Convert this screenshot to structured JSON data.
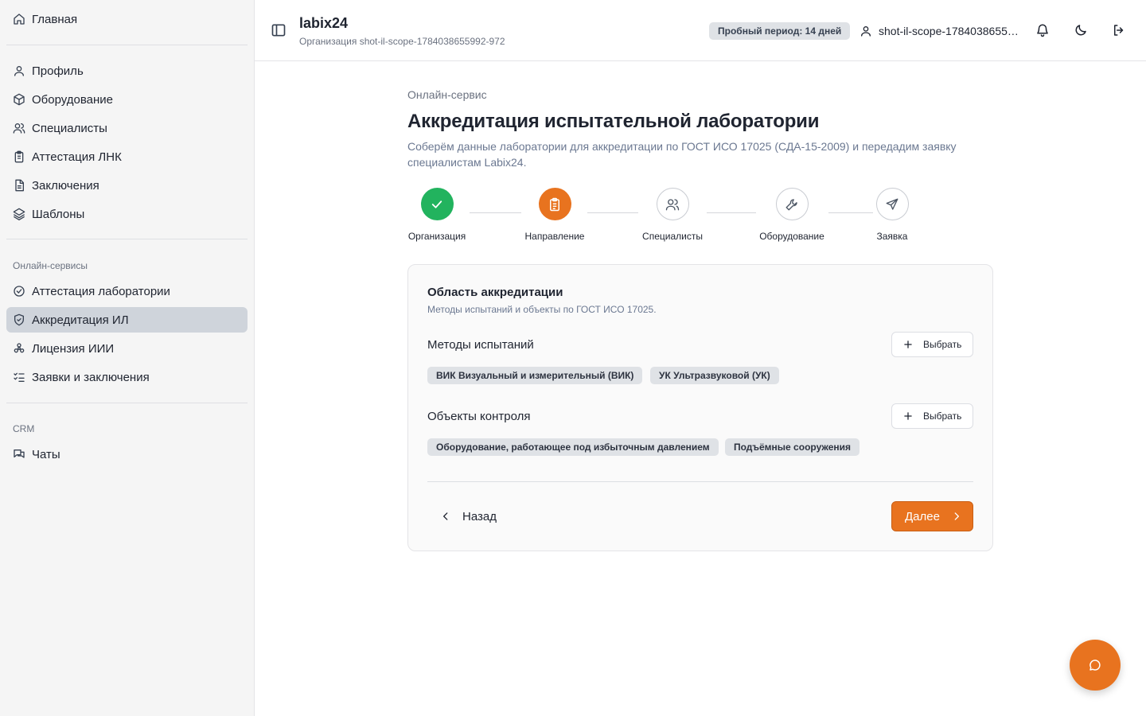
{
  "sidebar": {
    "home": "Главная",
    "items": [
      {
        "label": "Профиль",
        "icon": "user-icon"
      },
      {
        "label": "Оборудование",
        "icon": "box-icon"
      },
      {
        "label": "Специалисты",
        "icon": "users-icon"
      },
      {
        "label": "Аттестация ЛНК",
        "icon": "clipboard-icon"
      },
      {
        "label": "Заключения",
        "icon": "document-icon"
      },
      {
        "label": "Шаблоны",
        "icon": "layers-icon"
      }
    ],
    "online_section": "Онлайн-сервисы",
    "online_items": [
      {
        "label": "Аттестация лаборатории",
        "icon": "check-circle-icon"
      },
      {
        "label": "Аккредитация ИЛ",
        "icon": "shield-check-icon",
        "active": true
      },
      {
        "label": "Лицензия ИИИ",
        "icon": "radiation-icon"
      },
      {
        "label": "Заявки и заключения",
        "icon": "list-check-icon"
      }
    ],
    "crm_section": "CRM",
    "crm_items": [
      {
        "label": "Чаты",
        "icon": "chats-icon"
      }
    ]
  },
  "header": {
    "app_title": "labix24",
    "org_line": "Организация shot-il-scope-1784038655992-972",
    "trial_badge": "Пробный период: 14 дней",
    "user_name": "shot-il-scope-1784038655992-972"
  },
  "main": {
    "breadcrumb": "Онлайн-сервис",
    "title": "Аккредитация испытательной лаборатории",
    "description": "Соберём данные лаборатории для аккредитации по ГОСТ ИСО 17025 (СДА-15-2009) и передадим заявку специалистам Labix24.",
    "steps": [
      {
        "label": "Организация",
        "state": "done",
        "icon": "check-icon"
      },
      {
        "label": "Направление",
        "state": "current",
        "icon": "clipboard-list-icon"
      },
      {
        "label": "Специалисты",
        "state": "todo",
        "icon": "users-icon"
      },
      {
        "label": "Оборудование",
        "state": "todo",
        "icon": "wrench-icon"
      },
      {
        "label": "Заявка",
        "state": "todo",
        "icon": "send-icon"
      }
    ],
    "card": {
      "title": "Область аккредитации",
      "subtitle": "Методы испытаний и объекты по ГОСТ ИСО 17025.",
      "methods_label": "Методы испытаний",
      "methods": [
        "ВИК Визуальный и измерительный (ВИК)",
        "УК Ультразвуковой (УК)"
      ],
      "objects_label": "Объекты контроля",
      "objects": [
        "Оборудование, работающее под избыточным давлением",
        "Подъёмные сооружения"
      ],
      "pick_label": "Выбрать",
      "back_label": "Назад",
      "next_label": "Далее"
    }
  },
  "colors": {
    "accent": "#e8731f",
    "success": "#22b35e",
    "active_nav": "#cfd4db"
  }
}
